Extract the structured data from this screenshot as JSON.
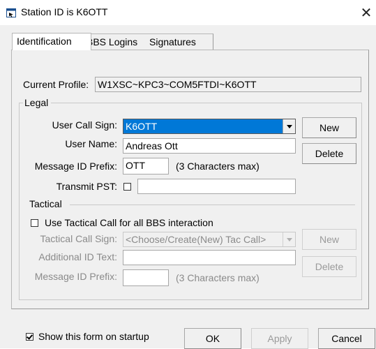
{
  "window": {
    "title": "Station ID is K6OTT",
    "close_glyph": "✕"
  },
  "tabs": [
    {
      "label": "Identification"
    },
    {
      "label": "BBS Logins"
    },
    {
      "label": "Signatures"
    }
  ],
  "profile": {
    "label": "Current Profile:",
    "value": "W1XSC~KPC3~COM5FTDI~K6OTT"
  },
  "legal": {
    "group_label": "Legal",
    "call_sign_label": "User Call Sign:",
    "call_sign_value": "K6OTT",
    "user_name_label": "User Name:",
    "user_name_value": "Andreas Ott",
    "msg_prefix_label": "Message ID Prefix:",
    "msg_prefix_value": "OTT",
    "msg_prefix_hint": "(3 Characters max)",
    "transmit_pst_label": "Transmit PST:",
    "transmit_pst_value": "",
    "new_button": "New",
    "delete_button": "Delete"
  },
  "tactical": {
    "group_label": "Tactical",
    "use_tactical_label": "Use Tactical Call for all BBS interaction",
    "tac_call_sign_label": "Tactical Call Sign:",
    "tac_call_sign_value": "<Choose/Create(New) Tac Call>",
    "additional_id_label": "Additional ID Text:",
    "additional_id_value": "",
    "msg_prefix_label": "Message ID Prefix:",
    "msg_prefix_value": "",
    "msg_prefix_hint": "(3 Characters max)",
    "new_button": "New",
    "delete_button": "Delete"
  },
  "footer": {
    "show_on_startup_label": "Show this form on startup",
    "ok_button": "OK",
    "apply_button": "Apply",
    "cancel_button": "Cancel"
  },
  "colors": {
    "selection": "#0078d7",
    "dialog_bg": "#f0f0f0"
  }
}
